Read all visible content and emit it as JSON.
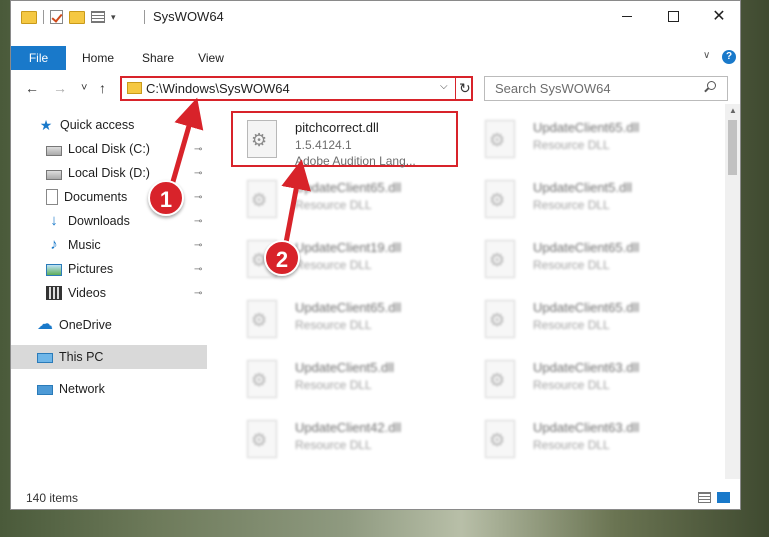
{
  "window": {
    "title": "SysWOW64",
    "controls": {
      "minimize": "minimize",
      "maximize": "maximize",
      "close": "✕"
    }
  },
  "ribbon": {
    "tabs": [
      "File",
      "Home",
      "Share",
      "View"
    ],
    "collapse_glyph": "∨",
    "help_glyph": "?"
  },
  "nav": {
    "back_glyph": "←",
    "forward_glyph": "→",
    "recent_glyph": "˅",
    "up_glyph": "↑",
    "address": "C:\\Windows\\SysWOW64",
    "address_dropdown_glyph": "⌵",
    "refresh_glyph": "↻",
    "search_placeholder": "Search SysWOW64"
  },
  "sidebar": {
    "items": [
      {
        "label": "Quick access",
        "icon": "star-icon",
        "pinned": false
      },
      {
        "label": "Local Disk (C:)",
        "icon": "disk-icon",
        "pinned": true
      },
      {
        "label": "Local Disk (D:)",
        "icon": "disk-icon",
        "pinned": true
      },
      {
        "label": "Documents",
        "icon": "documents-icon",
        "pinned": true
      },
      {
        "label": "Downloads",
        "icon": "downloads-icon",
        "pinned": true
      },
      {
        "label": "Music",
        "icon": "music-icon",
        "pinned": true
      },
      {
        "label": "Pictures",
        "icon": "pictures-icon",
        "pinned": true
      },
      {
        "label": "Videos",
        "icon": "videos-icon",
        "pinned": true
      },
      {
        "label": "OneDrive",
        "icon": "onedrive-icon",
        "pinned": false
      },
      {
        "label": "This PC",
        "icon": "this-pc-icon",
        "pinned": false,
        "selected": true
      },
      {
        "label": "Network",
        "icon": "network-icon",
        "pinned": false
      }
    ],
    "pin_glyph": "📌"
  },
  "files": [
    {
      "name": "pitchcorrect.dll",
      "line2": "1.5.4124.1",
      "line3": "Adobe Audition Lang...",
      "highlighted": true
    },
    {
      "name": "UpdateClient65.dll",
      "line2": "Resource DLL"
    },
    {
      "name": "UpdateClient65.dll",
      "line2": "Resource DLL"
    },
    {
      "name": "UpdateClient5.dll",
      "line2": "Resource DLL"
    },
    {
      "name": "UpdateClient19.dll",
      "line2": "Resource DLL"
    },
    {
      "name": "UpdateClient65.dll",
      "line2": "Resource DLL"
    },
    {
      "name": "UpdateClient65.dll",
      "line2": "Resource DLL"
    },
    {
      "name": "UpdateClient65.dll",
      "line2": "Resource DLL"
    },
    {
      "name": "UpdateClient5.dll",
      "line2": "Resource DLL"
    },
    {
      "name": "UpdateClient63.dll",
      "line2": "Resource DLL"
    },
    {
      "name": "UpdateClient42.dll",
      "line2": "Resource DLL"
    },
    {
      "name": "UpdateClient63.dll",
      "line2": "Resource DLL"
    }
  ],
  "status": {
    "item_count": "140 items"
  },
  "annotations": [
    {
      "label": "1"
    },
    {
      "label": "2"
    }
  ],
  "colors": {
    "accent": "#1979ca",
    "highlight": "#d8232a"
  }
}
